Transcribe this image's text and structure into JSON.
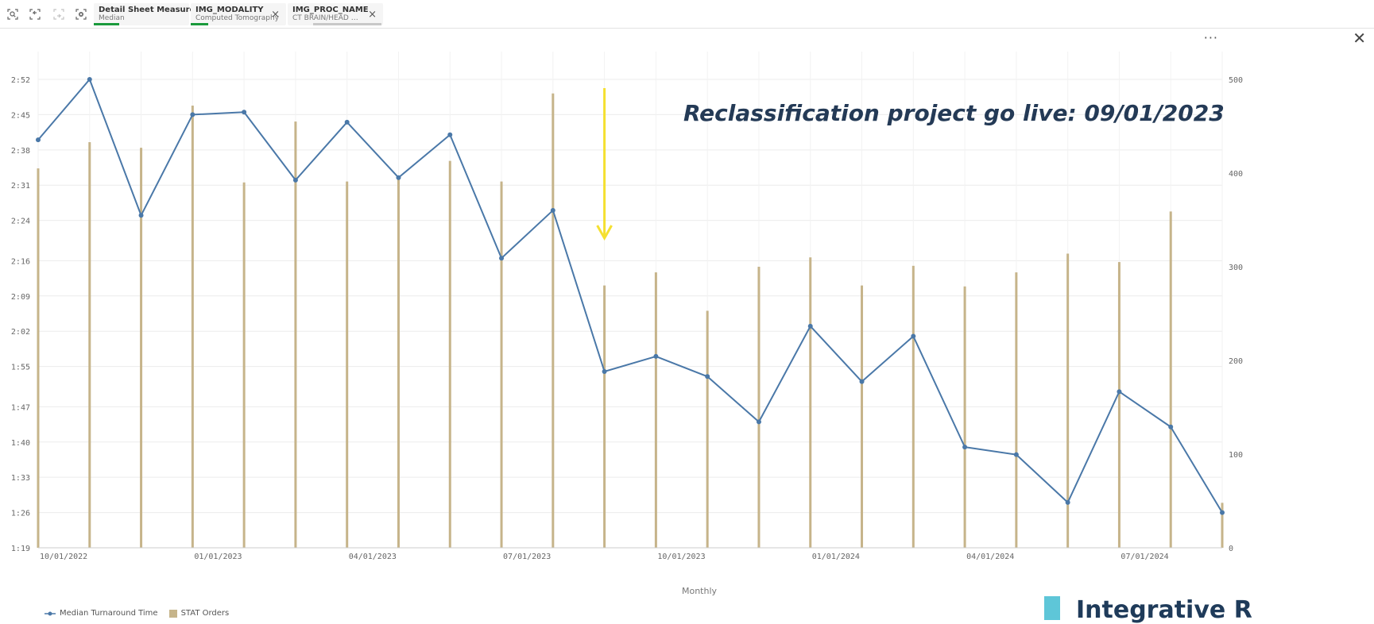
{
  "toolbar": {
    "chips": [
      {
        "title": "Detail Sheet Measure Type",
        "value": "Median",
        "bar_color": "#1a9a3c",
        "closable": false
      },
      {
        "title": "IMG_MODALITY",
        "value": "Computed Tomography",
        "bar_color": "#1a9a3c",
        "closable": true
      },
      {
        "title": "IMG_PROC_NAME",
        "value": "CT BRAIN/HEAD WO CO...",
        "bar_color": "#c8c8c8",
        "closable": true
      }
    ],
    "close_glyph": "×"
  },
  "menu": {
    "more_glyph": "···",
    "close_glyph": "✕"
  },
  "legend": {
    "line_label": "Median Turnaround Time",
    "bar_label": "STAT Orders"
  },
  "brand_text": "Integrative R",
  "colors": {
    "line": "#4a78a8",
    "bars": "#c6b48a",
    "annotation_arrow": "#f5e030",
    "annotation_text": "#243a56"
  },
  "chart_data": {
    "type": "bar+line",
    "xlabel": "Monthly",
    "x_tick_labels": [
      "10/01/2022",
      "01/01/2023",
      "04/01/2023",
      "07/01/2023",
      "10/01/2023",
      "01/01/2024",
      "04/01/2024",
      "07/01/2024"
    ],
    "x_tick_month_index": [
      0,
      3,
      6,
      9,
      12,
      15,
      18,
      21
    ],
    "months": [
      "10/2022",
      "11/2022",
      "12/2022",
      "01/2023",
      "02/2023",
      "03/2023",
      "04/2023",
      "05/2023",
      "06/2023",
      "07/2023",
      "08/2023",
      "09/2023",
      "10/2023",
      "11/2023",
      "12/2023",
      "01/2024",
      "02/2024",
      "03/2024",
      "04/2024",
      "05/2024",
      "06/2024",
      "07/2024",
      "08/2024",
      "09/2024"
    ],
    "left_axis": {
      "ticks": [
        "1:19",
        "1:26",
        "1:33",
        "1:40",
        "1:47",
        "1:55",
        "2:02",
        "2:09",
        "2:16",
        "2:24",
        "2:31",
        "2:38",
        "2:45",
        "2:52"
      ],
      "ylim_minutes": [
        79,
        172
      ],
      "tick_minutes": [
        79,
        86,
        93,
        100,
        107,
        115,
        122,
        129,
        136,
        144,
        151,
        158,
        165,
        172
      ]
    },
    "right_axis": {
      "ticks": [
        "0",
        "100",
        "200",
        "300",
        "400",
        "500"
      ],
      "ylim": [
        0,
        500
      ],
      "tick_values": [
        0,
        100,
        200,
        300,
        400,
        500
      ]
    },
    "series": [
      {
        "name": "Median Turnaround Time",
        "kind": "line",
        "axis": "left",
        "unit": "minutes",
        "values": [
          160,
          172,
          145,
          165,
          165.5,
          152,
          163.5,
          152.5,
          161,
          136.5,
          146,
          114,
          117,
          113,
          104,
          123,
          112,
          121,
          99,
          97.5,
          88,
          110,
          103,
          86
        ]
      },
      {
        "name": "STAT Orders",
        "kind": "bar",
        "axis": "right",
        "values": [
          405,
          433,
          427,
          472,
          390,
          455,
          391,
          397,
          413,
          391,
          485,
          280,
          294,
          253,
          300,
          310,
          280,
          301,
          279,
          294,
          314,
          305,
          359,
          48
        ]
      }
    ],
    "annotation": {
      "text": "Reclassification project go live: 09/01/2023",
      "month_index": 11
    },
    "grid": true,
    "legend_position": "bottom-left"
  }
}
